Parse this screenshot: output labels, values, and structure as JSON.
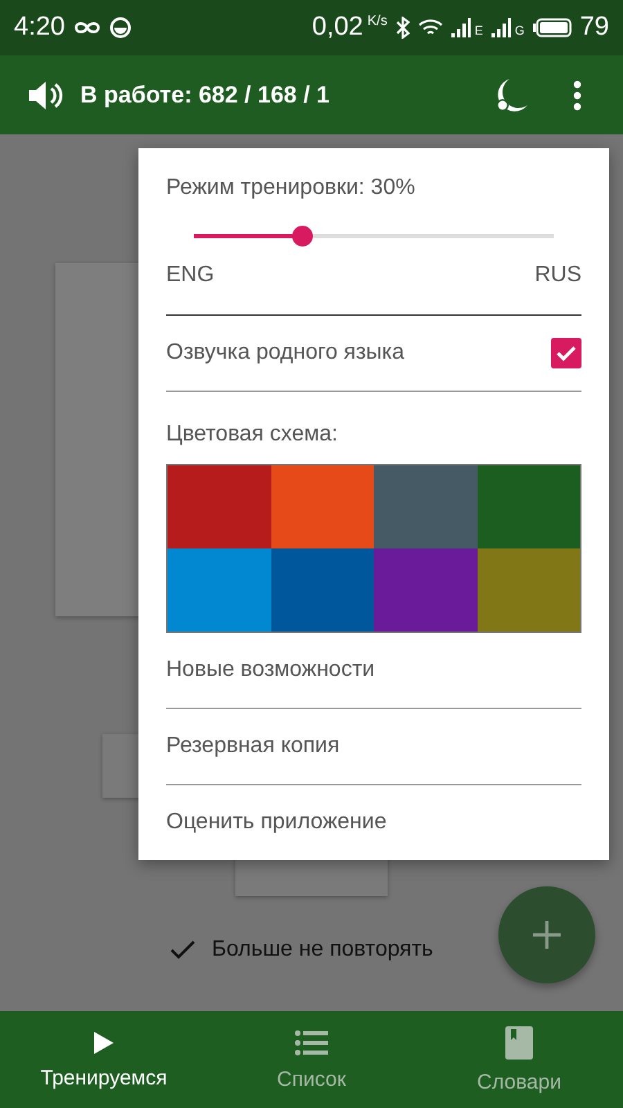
{
  "status_bar": {
    "time": "4:20",
    "speed": "0,02",
    "speed_unit": "K/s",
    "network_1": "E",
    "network_2": "G",
    "battery": "79"
  },
  "app_bar": {
    "title": "В работе: 682 / 168 / 1"
  },
  "background": {
    "checkbox_label": "Больше не повторять",
    "checked": true
  },
  "menu": {
    "slider_label": "Режим тренировки: 30%",
    "level": 0.3,
    "left_label": "ENG",
    "right_label": "RUS",
    "toggle": {
      "label": "Озвучка родного языка",
      "checked": true
    },
    "scheme_label": "Цветовая схема:",
    "colors": [
      {
        "color": "#b71c1c"
      },
      {
        "color": "#e64a19"
      },
      {
        "color": "#455a64"
      },
      {
        "color": "#1b5e20"
      },
      {
        "color": "#0288d1"
      },
      {
        "color": "#01579b"
      },
      {
        "color": "#6a1b9a"
      },
      {
        "color": "#827717"
      }
    ],
    "items": [
      "Новые возможности",
      "Резервная копия",
      "Оценить приложение"
    ]
  },
  "bottom_nav": [
    {
      "label": "Тренируемся",
      "kind": "play",
      "selected": true
    },
    {
      "label": "Список",
      "kind": "list",
      "selected": false
    },
    {
      "label": "Словари",
      "kind": "book",
      "selected": false
    }
  ]
}
